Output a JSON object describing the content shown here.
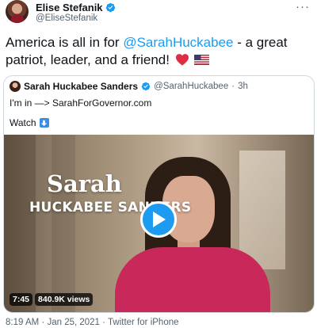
{
  "author": {
    "display_name": "Elise Stefanik",
    "handle": "@EliseStefanik",
    "more_label": "···"
  },
  "tweet": {
    "text_before": "America is all in for ",
    "mention": "@SarahHuckabee",
    "text_after": " - a great patriot, leader, and a friend!",
    "emoji": [
      "red-heart",
      "us-flag"
    ]
  },
  "quoted": {
    "display_name": "Sarah Huckabee Sanders",
    "handle": "@SarahHuckabee",
    "separator": "·",
    "time": "3h",
    "line1": "I'm in —> SarahForGovernor.com",
    "line2": "Watch"
  },
  "video": {
    "title_line1": "Sarah",
    "title_line2": "HUCKABEE SANDERS",
    "duration": "7:45",
    "views": "840.9K views"
  },
  "footer": {
    "time": "8:19 AM",
    "date": "Jan 25, 2021",
    "source": "Twitter for iPhone",
    "separator": "·"
  },
  "colors": {
    "accent": "#1d9bf0",
    "text": "#0f1419",
    "muted": "#536471",
    "border": "#cfd9de"
  }
}
